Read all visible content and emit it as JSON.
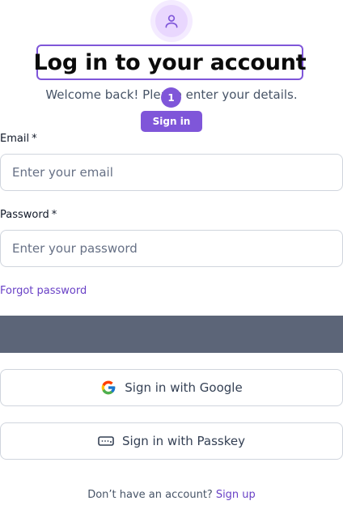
{
  "header": {
    "avatar_icon": "user-icon",
    "title": "Log in to your account",
    "subtitle": "Welcome back! Please enter your details.",
    "badge": "1",
    "signin_button": "Sign in"
  },
  "form": {
    "email_label": "Email",
    "email_required": "*",
    "email_placeholder": "Enter your email",
    "password_label": "Password",
    "password_required": "*",
    "password_placeholder": "Enter your password",
    "forgot_password": "Forgot password"
  },
  "sso": {
    "google_label": "Sign in with Google",
    "google_icon": "google-icon",
    "passkey_label": "Sign in with Passkey",
    "passkey_icon": "passkey-icon"
  },
  "footer": {
    "prompt": "Don’t have an account?",
    "signup_link": "Sign up"
  },
  "colors": {
    "accent": "#7f56d9",
    "link": "#6941c6",
    "dark_bar": "#5c6479"
  }
}
